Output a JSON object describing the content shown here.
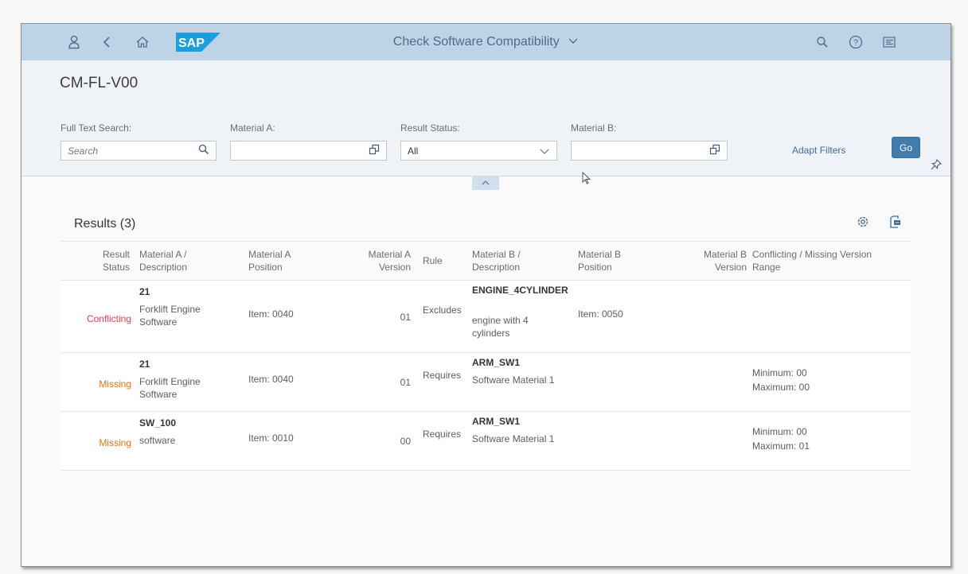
{
  "shell": {
    "title": "Check Software Compatibility",
    "icons": [
      "user-icon",
      "back-icon",
      "home-icon",
      "search-icon",
      "help-icon",
      "notifications-icon"
    ],
    "logo_text": "SAP"
  },
  "header": {
    "page_title": "CM-FL-V00",
    "filters": {
      "full_text_search": {
        "label": "Full Text Search:",
        "placeholder": "Search",
        "value": ""
      },
      "material_a": {
        "label": "Material A:",
        "value": ""
      },
      "result_status": {
        "label": "Result Status:",
        "value": "All"
      },
      "material_b": {
        "label": "Material B:",
        "value": ""
      }
    },
    "adapt_filters_label": "Adapt Filters",
    "go_label": "Go"
  },
  "results": {
    "title": "Results (3)",
    "columns": [
      "Result Status",
      "Material A / Description",
      "Material A Position",
      "Material A Version",
      "Rule",
      "Material B / Description",
      "Material B Position",
      "Material B Version",
      "Conflicting / Missing Version Range"
    ],
    "column_lines": [
      [
        "Result",
        "Status"
      ],
      [
        "Material A /",
        "Description"
      ],
      [
        "Material A",
        "Position"
      ],
      [
        "Material A",
        "Version"
      ],
      [
        "Rule"
      ],
      [
        "Material B /",
        "Description"
      ],
      [
        "Material B",
        "Position"
      ],
      [
        "Material B",
        "Version"
      ],
      [
        "Conflicting / Missing Version",
        "Range"
      ]
    ],
    "rows": [
      {
        "status": "Conflicting",
        "mat_a_id": "21",
        "mat_a_desc": "Forklift Engine Software",
        "mat_a_pos": "Item: 0040",
        "mat_a_ver": "01",
        "rule": "Excludes",
        "mat_b_id": "ENGINE_4CYLINDER",
        "mat_b_desc": "engine with 4 cylinders",
        "mat_b_pos": "Item: 0050",
        "mat_b_ver": "",
        "range_min": "",
        "range_max": ""
      },
      {
        "status": "Missing",
        "mat_a_id": "21",
        "mat_a_desc": "Forklift Engine Software",
        "mat_a_pos": "Item: 0040",
        "mat_a_ver": "01",
        "rule": "Requires",
        "mat_b_id": "ARM_SW1",
        "mat_b_desc": "Software Material 1",
        "mat_b_pos": "",
        "mat_b_ver": "",
        "range_min": "Minimum: 00",
        "range_max": "Maximum: 00"
      },
      {
        "status": "Missing",
        "mat_a_id": "SW_100",
        "mat_a_desc": "software",
        "mat_a_pos": "Item: 0010",
        "mat_a_ver": "00",
        "rule": "Requires",
        "mat_b_id": "ARM_SW1",
        "mat_b_desc": "Software Material 1",
        "mat_b_pos": "",
        "mat_b_ver": "",
        "range_min": "Minimum: 00",
        "range_max": "Maximum: 01"
      }
    ]
  },
  "colors": {
    "shell_bg": "#bfd3e7",
    "header_bg": "#eff3f8",
    "accent": "#427cac",
    "conflicting": "#e0404f",
    "missing": "#e9730c"
  }
}
